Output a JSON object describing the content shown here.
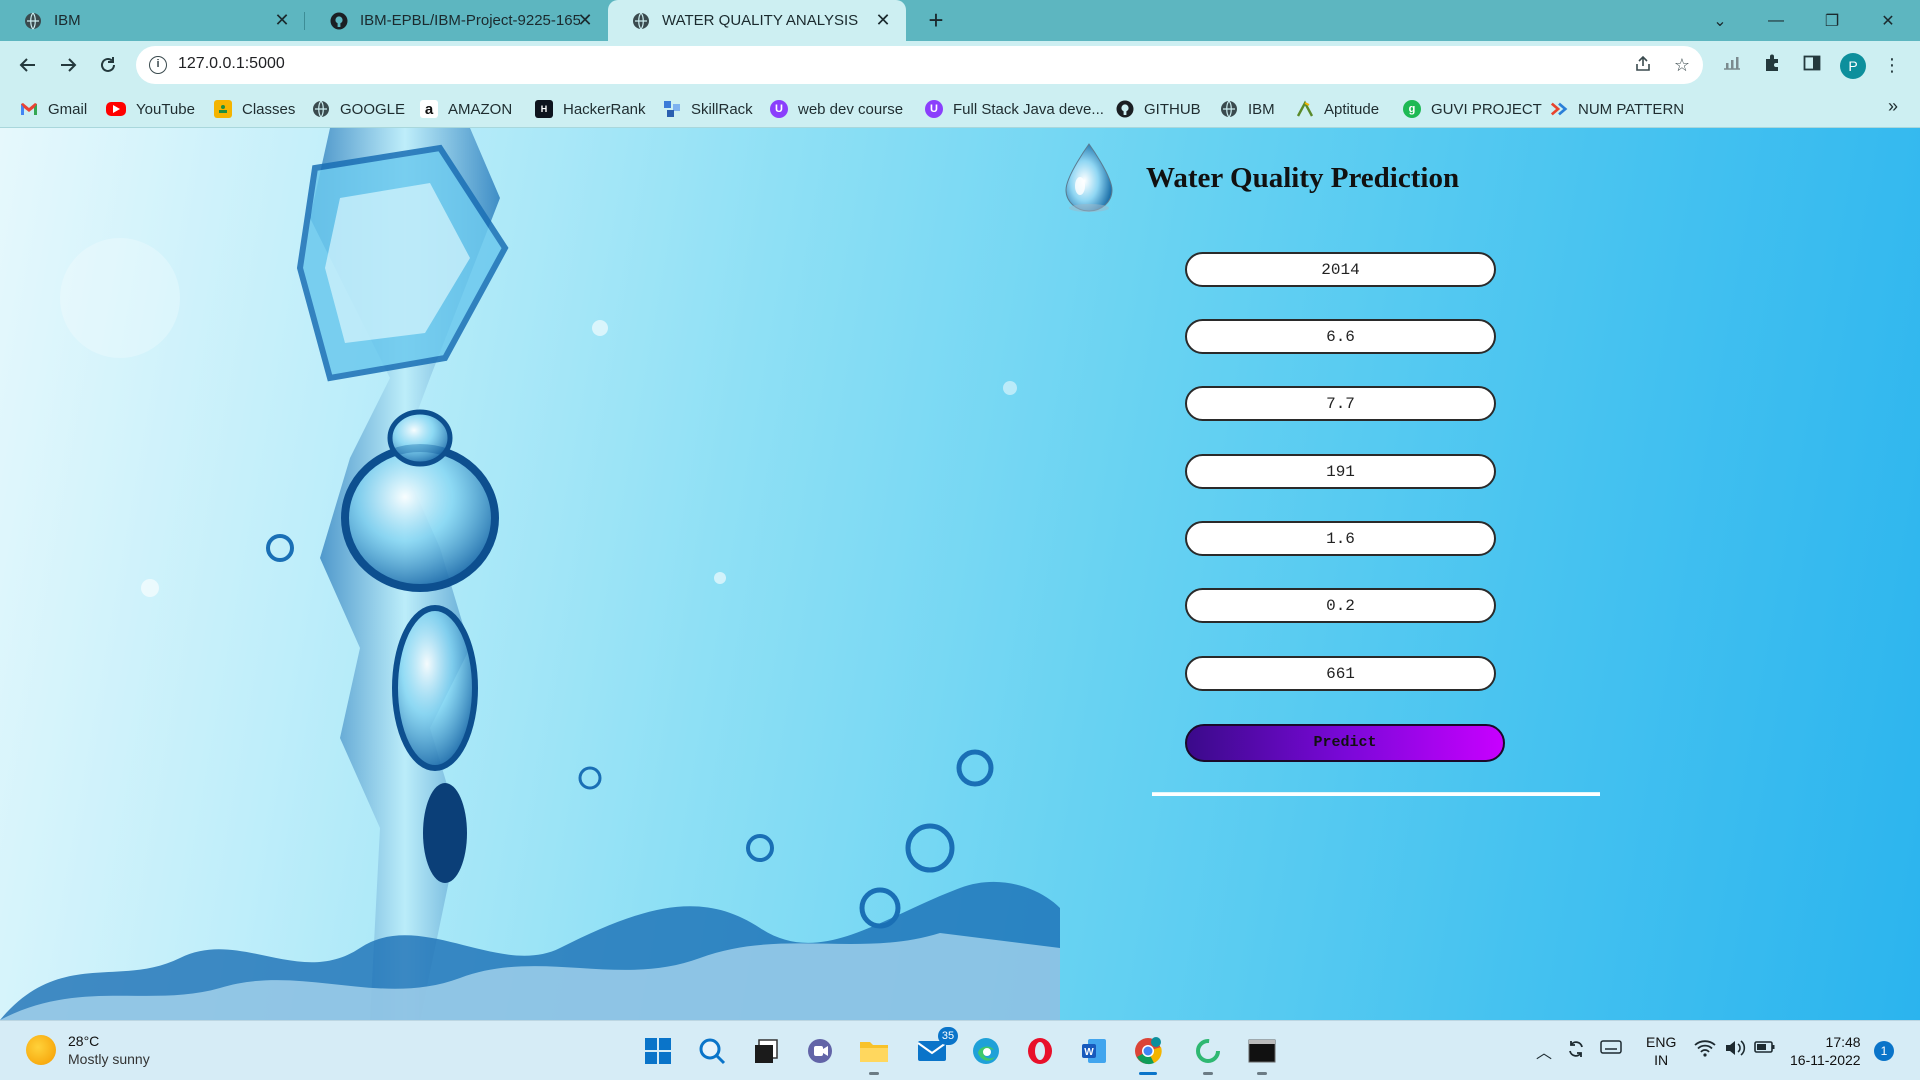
{
  "browser": {
    "tabs": [
      {
        "title": "IBM",
        "icon": "globe-icon"
      },
      {
        "title": "IBM-EPBL/IBM-Project-9225-165",
        "icon": "github-icon"
      },
      {
        "title": "WATER QUALITY ANALYSIS",
        "icon": "globe-icon"
      }
    ],
    "new_tab": "+",
    "window": {
      "dropdown": "⌄",
      "minimize": "—",
      "restore": "❐",
      "close": "✕"
    },
    "url": "127.0.0.1:5000",
    "profile_initial": "P"
  },
  "bookmarks": [
    {
      "label": "Gmail",
      "icon": "gmail-icon",
      "color": "#ea4335"
    },
    {
      "label": "YouTube",
      "icon": "youtube-icon",
      "color": "#ff0000"
    },
    {
      "label": "Classes",
      "icon": "classroom-icon",
      "color": "#f4b400"
    },
    {
      "label": "GOOGLE",
      "icon": "globe-icon",
      "color": "#3a4a4e"
    },
    {
      "label": "AMAZON",
      "icon": "amazon-icon",
      "color": "#111111"
    },
    {
      "label": "HackerRank",
      "icon": "hackerrank-icon",
      "color": "#0e141e"
    },
    {
      "label": "SkillRack",
      "icon": "skillrack-icon",
      "color": "#3b7bd8"
    },
    {
      "label": "web dev course",
      "icon": "course-icon",
      "color": "#8a3ffc"
    },
    {
      "label": "Full Stack Java deve...",
      "icon": "course-icon",
      "color": "#8a3ffc"
    },
    {
      "label": "GITHUB",
      "icon": "github-icon",
      "color": "#111111"
    },
    {
      "label": "IBM",
      "icon": "globe-icon",
      "color": "#3a4a4e"
    },
    {
      "label": "Aptitude",
      "icon": "aptitude-icon",
      "color": "#5a8a2a"
    },
    {
      "label": "GUVI PROJECT",
      "icon": "guvi-icon",
      "color": "#1db954"
    },
    {
      "label": "NUM PATTERN",
      "icon": "numpattern-icon",
      "color": "#e8442e"
    }
  ],
  "page": {
    "title": "Water Quality Prediction",
    "fields": [
      "2014",
      "6.6",
      "7.7",
      "191",
      "1.6",
      "0.2",
      "661"
    ],
    "predict_label": "Predict"
  },
  "taskbar": {
    "weather_temp": "28°C",
    "weather_desc": "Mostly sunny",
    "mail_badge": "35",
    "lang_1": "ENG",
    "lang_2": "IN",
    "time": "17:48",
    "date": "16-11-2022",
    "notifications": "1"
  }
}
